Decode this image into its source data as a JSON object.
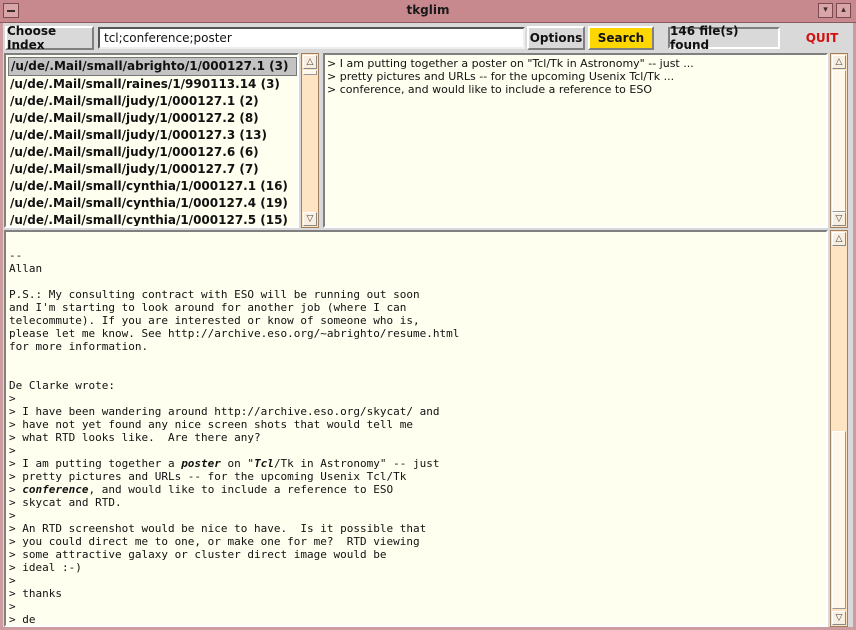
{
  "window": {
    "title": "tkglim"
  },
  "toolbar": {
    "choose_index_label": "Choose Index",
    "search_value": "tcl;conference;poster",
    "options_label": "Options",
    "search_label": "Search",
    "found_label": "146 file(s) found",
    "quit_label": "QUIT"
  },
  "colors": {
    "search_button": "#ffd700",
    "quit_text": "#d41010",
    "pane_bg": "#fffff0",
    "scrollbar": "#ffe4c4"
  },
  "files": [
    "/u/de/.Mail/small/abrighto/1/000127.1 (3)",
    "/u/de/.Mail/small/raines/1/990113.14 (3)",
    "/u/de/.Mail/small/judy/1/000127.1 (2)",
    "/u/de/.Mail/small/judy/1/000127.2 (8)",
    "/u/de/.Mail/small/judy/1/000127.3 (13)",
    "/u/de/.Mail/small/judy/1/000127.6 (6)",
    "/u/de/.Mail/small/judy/1/000127.7 (7)",
    "/u/de/.Mail/small/cynthia/1/000127.1 (16)",
    "/u/de/.Mail/small/cynthia/1/000127.4 (19)",
    "/u/de/.Mail/small/cynthia/1/000127.5 (15)"
  ],
  "preview": [
    "> I am putting together a poster on \"Tcl/Tk in Astronomy\" -- just ...",
    "> pretty pictures and URLs -- for the upcoming Usenix Tcl/Tk ...",
    "> conference, and would like to include a reference to ESO"
  ],
  "message": [
    [
      {
        "t": ""
      }
    ],
    [
      {
        "t": "--"
      }
    ],
    [
      {
        "t": "Allan"
      }
    ],
    [
      {
        "t": ""
      }
    ],
    [
      {
        "t": "P.S.: My consulting contract with ESO will be running out soon"
      }
    ],
    [
      {
        "t": "and I'm starting to look around for another job (where I can"
      }
    ],
    [
      {
        "t": "telecommute). If you are interested or know of someone who is,"
      }
    ],
    [
      {
        "t": "please let me know. See http://archive.eso.org/~abrighto/resume.html"
      }
    ],
    [
      {
        "t": "for more information."
      }
    ],
    [
      {
        "t": ""
      }
    ],
    [
      {
        "t": ""
      }
    ],
    [
      {
        "t": "De Clarke wrote:"
      }
    ],
    [
      {
        "t": ">"
      }
    ],
    [
      {
        "t": "> I have been wandering around http://archive.eso.org/skycat/ and"
      }
    ],
    [
      {
        "t": "> have not yet found any nice screen shots that would tell me"
      }
    ],
    [
      {
        "t": "> what RTD looks like.  Are there any?"
      }
    ],
    [
      {
        "t": ">"
      }
    ],
    [
      {
        "t": "> I am putting together a "
      },
      {
        "t": "poster",
        "h": true
      },
      {
        "t": " on \""
      },
      {
        "t": "Tcl",
        "h": true
      },
      {
        "t": "/Tk in Astronomy\" -- just"
      }
    ],
    [
      {
        "t": "> pretty pictures and URLs -- for the upcoming Usenix Tcl/Tk"
      }
    ],
    [
      {
        "t": "> "
      },
      {
        "t": "conference",
        "h": true
      },
      {
        "t": ", and would like to include a reference to ESO"
      }
    ],
    [
      {
        "t": "> skycat and RTD."
      }
    ],
    [
      {
        "t": ">"
      }
    ],
    [
      {
        "t": "> An RTD screenshot would be nice to have.  Is it possible that"
      }
    ],
    [
      {
        "t": "> you could direct me to one, or make one for me?  RTD viewing"
      }
    ],
    [
      {
        "t": "> some attractive galaxy or cluster direct image would be"
      }
    ],
    [
      {
        "t": "> ideal :-)"
      }
    ],
    [
      {
        "t": ">"
      }
    ],
    [
      {
        "t": "> thanks"
      }
    ],
    [
      {
        "t": ">"
      }
    ],
    [
      {
        "t": "> de"
      }
    ]
  ]
}
